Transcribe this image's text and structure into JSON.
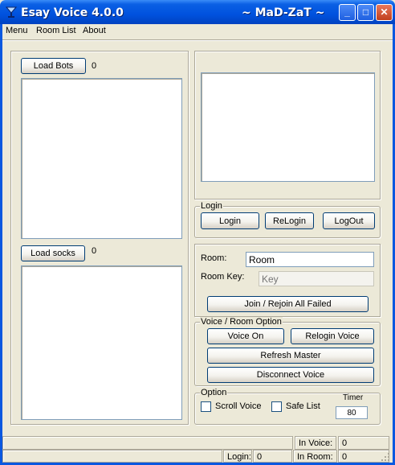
{
  "window": {
    "title": "Esay Voice 4.0.0",
    "subtitle": "~ MaD-ZaT ~",
    "controls": {
      "minimize": "_",
      "maximize": "□",
      "close": "✕"
    }
  },
  "menu": [
    "Menu",
    "Room List",
    "About"
  ],
  "bots": {
    "button": "Load Bots",
    "count": "0"
  },
  "socks": {
    "button": "Load socks",
    "count": "0"
  },
  "login": {
    "legend": "Login",
    "login_button": "Login",
    "relogin_button": "ReLogin",
    "logout_button": "LogOut"
  },
  "room": {
    "room_label": "Room:",
    "room_value": "Room",
    "key_label": "Room Key:",
    "key_placeholder": "Key",
    "join_button": "Join / Rejoin All Failed"
  },
  "voice": {
    "legend": "Voice / Room Option",
    "voice_on_button": "Voice On",
    "relogin_voice_button": "Relogin Voice",
    "refresh_master_button": "Refresh Master",
    "disconnect_voice_button": "Disconnect Voice"
  },
  "option": {
    "legend": "Option",
    "scroll_voice_label": "Scroll Voice",
    "scroll_voice_checked": false,
    "safe_list_label": "Safe List",
    "safe_list_checked": false,
    "timer_label": "Timer",
    "timer_value": "80"
  },
  "status": {
    "in_voice_label": "In Voice:",
    "in_voice_value": "0",
    "login_label": "Login:",
    "login_value": "0",
    "in_room_label": "In Room:",
    "in_room_value": "0"
  },
  "colors": {
    "titlebar": "#0052DE",
    "face": "#ECE9D8",
    "button_border": "#003C74"
  }
}
